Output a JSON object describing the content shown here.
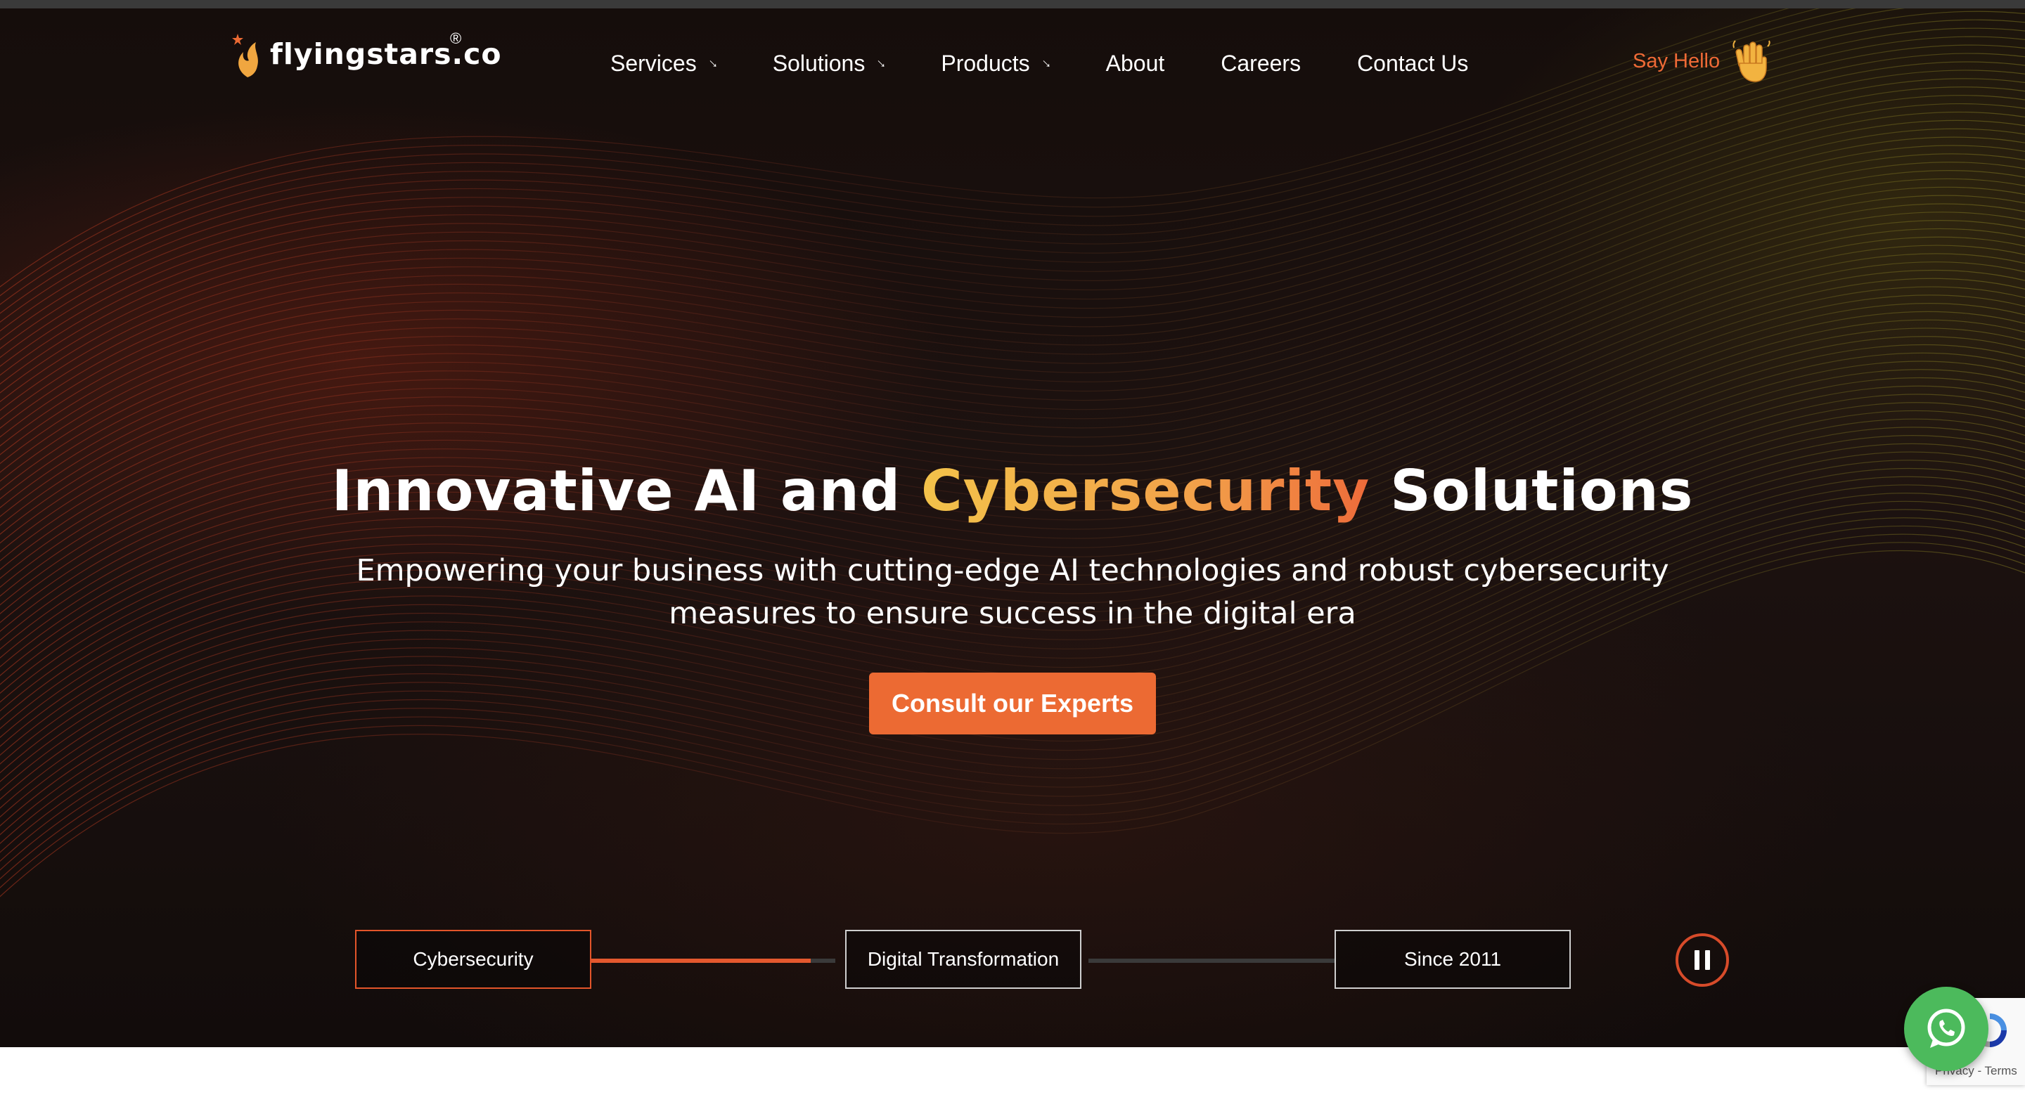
{
  "brand": {
    "name": "flyingstars.co",
    "registered_mark": "®"
  },
  "nav": {
    "items": [
      {
        "label": "Services",
        "has_dropdown": true
      },
      {
        "label": "Solutions",
        "has_dropdown": true
      },
      {
        "label": "Products",
        "has_dropdown": true
      },
      {
        "label": "About",
        "has_dropdown": false
      },
      {
        "label": "Careers",
        "has_dropdown": false
      },
      {
        "label": "Contact Us",
        "has_dropdown": false
      }
    ],
    "dropdown_arrow": "↓",
    "say_hello": "Say Hello",
    "say_hello_icon": "waving-hand-icon"
  },
  "hero": {
    "headline_part1": "Innovative AI and ",
    "headline_accent": "Cybersecurity",
    "headline_part2": " Solutions",
    "subheadline_line1": "Empowering your business with cutting-edge AI technologies and robust cybersecurity",
    "subheadline_line2": "measures to ensure success in the digital era",
    "cta_label": "Consult our Experts"
  },
  "timeline": {
    "items": [
      {
        "label": "Cybersecurity",
        "active": true
      },
      {
        "label": "Digital Transformation",
        "active": false
      },
      {
        "label": "Since 2011",
        "active": false
      }
    ],
    "progress": [
      0.9,
      0.0
    ],
    "pause_icon": "pause-icon"
  },
  "recaptcha": {
    "text": "Privacy - Terms"
  },
  "colors": {
    "accent_orange": "#ec6a33",
    "accent_gold": "#f3c24a",
    "hero_bg": "#1a100e",
    "whatsapp_green": "#4cba5c"
  }
}
